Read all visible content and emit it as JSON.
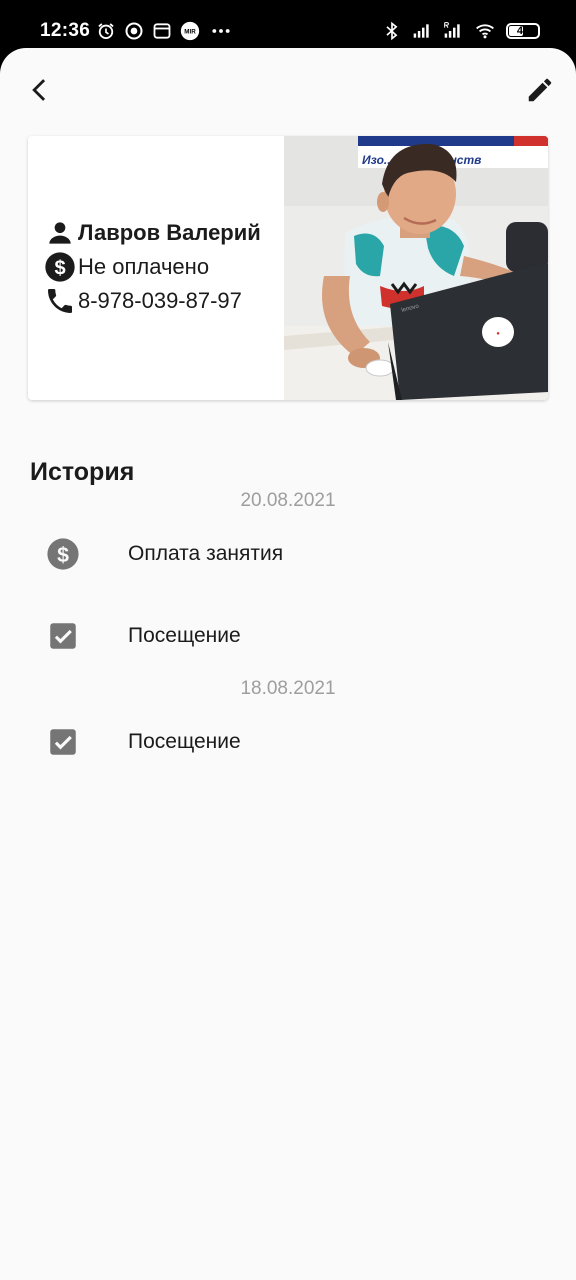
{
  "status_bar": {
    "time": "12:36",
    "left_icons": [
      "alarm-icon",
      "target-icon",
      "window-icon",
      "mir-icon",
      "more-dots-icon"
    ],
    "mir_label": "MIR",
    "right_icons": [
      "bluetooth-icon",
      "signal-icon",
      "signal-roaming-icon",
      "wifi-icon"
    ],
    "battery": "48",
    "battery_level": 0.48
  },
  "toolbar": {
    "back_icon": "arrow-back-icon",
    "edit_icon": "pencil-icon"
  },
  "student": {
    "name": "Лавров Валерий",
    "payment_status": "Не оплачено",
    "phone": "8-978-039-87-97",
    "photo_caption": "Изо... совершенств",
    "icons": [
      "person-icon",
      "dollar-circle-icon",
      "phone-icon"
    ]
  },
  "history": {
    "title": "История",
    "groups": [
      {
        "date": "20.08.2021",
        "items": [
          {
            "label": "Оплата занятия",
            "icon": "dollar-circle-icon"
          },
          {
            "label": "Посещение",
            "icon": "checkbox-checked-icon"
          }
        ]
      },
      {
        "date": "18.08.2021",
        "items": [
          {
            "label": "Посещение",
            "icon": "checkbox-checked-icon"
          }
        ]
      }
    ]
  },
  "colors": {
    "background": "#fafafa",
    "text": "#1b1b1b",
    "muted": "#9e9e9e",
    "icon_gray": "#757575"
  }
}
